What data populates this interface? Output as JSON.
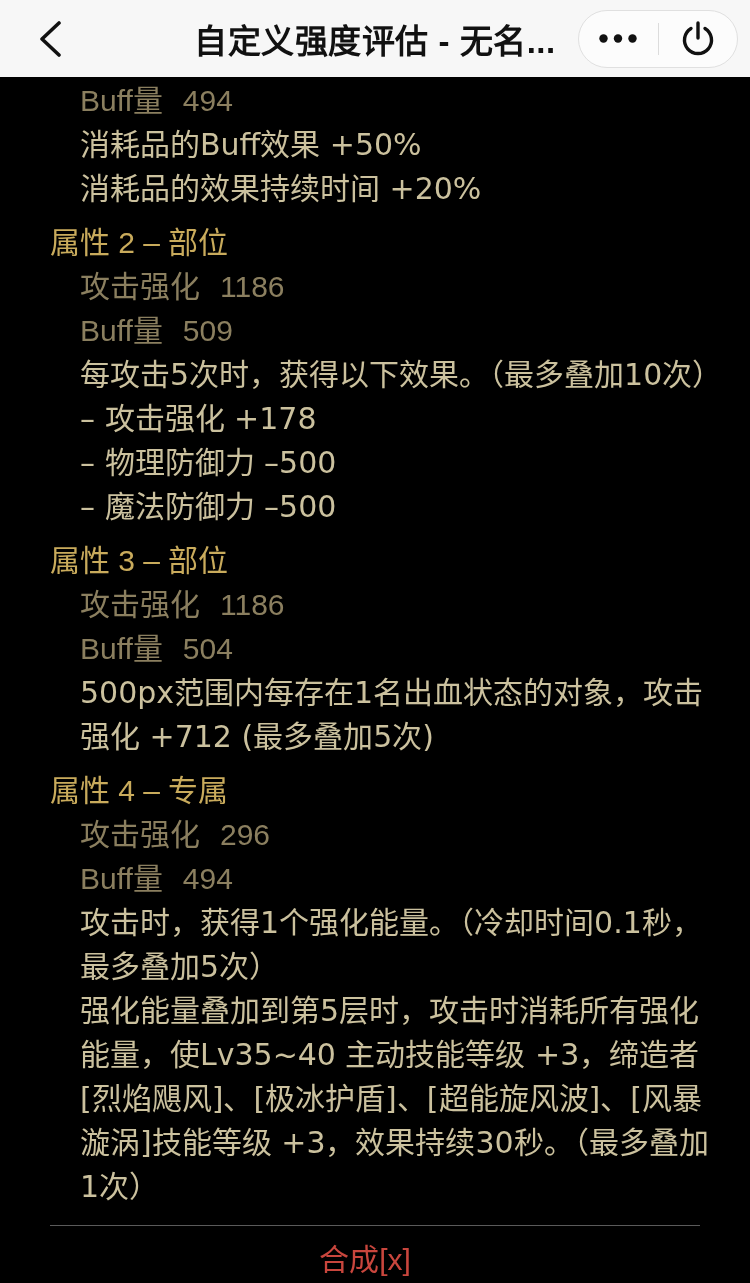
{
  "header": {
    "title": "自定义强度评估 - 无名..."
  },
  "sections": [
    {
      "lines": [
        {
          "kind": "stat",
          "label": "Buff量",
          "value": "494"
        },
        {
          "kind": "effect",
          "text": "消耗品的Buff效果 +50%"
        },
        {
          "kind": "effect",
          "text": "消耗品的效果持续时间 +20%"
        }
      ]
    },
    {
      "heading": "属性 2 – 部位",
      "lines": [
        {
          "kind": "stat",
          "label": "攻击强化",
          "value": "1186"
        },
        {
          "kind": "stat",
          "label": "Buff量",
          "value": "509"
        },
        {
          "kind": "effect",
          "text": "每攻击5次时，获得以下效果。（最多叠加10次）"
        },
        {
          "kind": "effect",
          "text": "– 攻击强化 +178"
        },
        {
          "kind": "effect",
          "text": "– 物理防御力 –500"
        },
        {
          "kind": "effect",
          "text": "– 魔法防御力 –500"
        }
      ]
    },
    {
      "heading": "属性 3 – 部位",
      "lines": [
        {
          "kind": "stat",
          "label": "攻击强化",
          "value": "1186"
        },
        {
          "kind": "stat",
          "label": "Buff量",
          "value": "504"
        },
        {
          "kind": "effect",
          "text": "500px范围内每存在1名出血状态的对象，攻击强化 +712 (最多叠加5次)"
        }
      ]
    },
    {
      "heading": "属性 4 – 专属",
      "lines": [
        {
          "kind": "stat",
          "label": "攻击强化",
          "value": "296"
        },
        {
          "kind": "stat",
          "label": "Buff量",
          "value": "494"
        },
        {
          "kind": "effect",
          "text": "攻击时，获得1个强化能量。（冷却时间0.1秒，最多叠加5次）"
        },
        {
          "kind": "effect",
          "text": "强化能量叠加到第5层时，攻击时消耗所有强化能量，使Lv35~40 主动技能等级 +3，缔造者[烈焰飓风]、[极冰护盾]、[超能旋风波]、[风暴漩涡]技能等级 +3，效果持续30秒。（最多叠加1次）"
        }
      ]
    }
  ],
  "footer": {
    "link": "合成[x]"
  }
}
